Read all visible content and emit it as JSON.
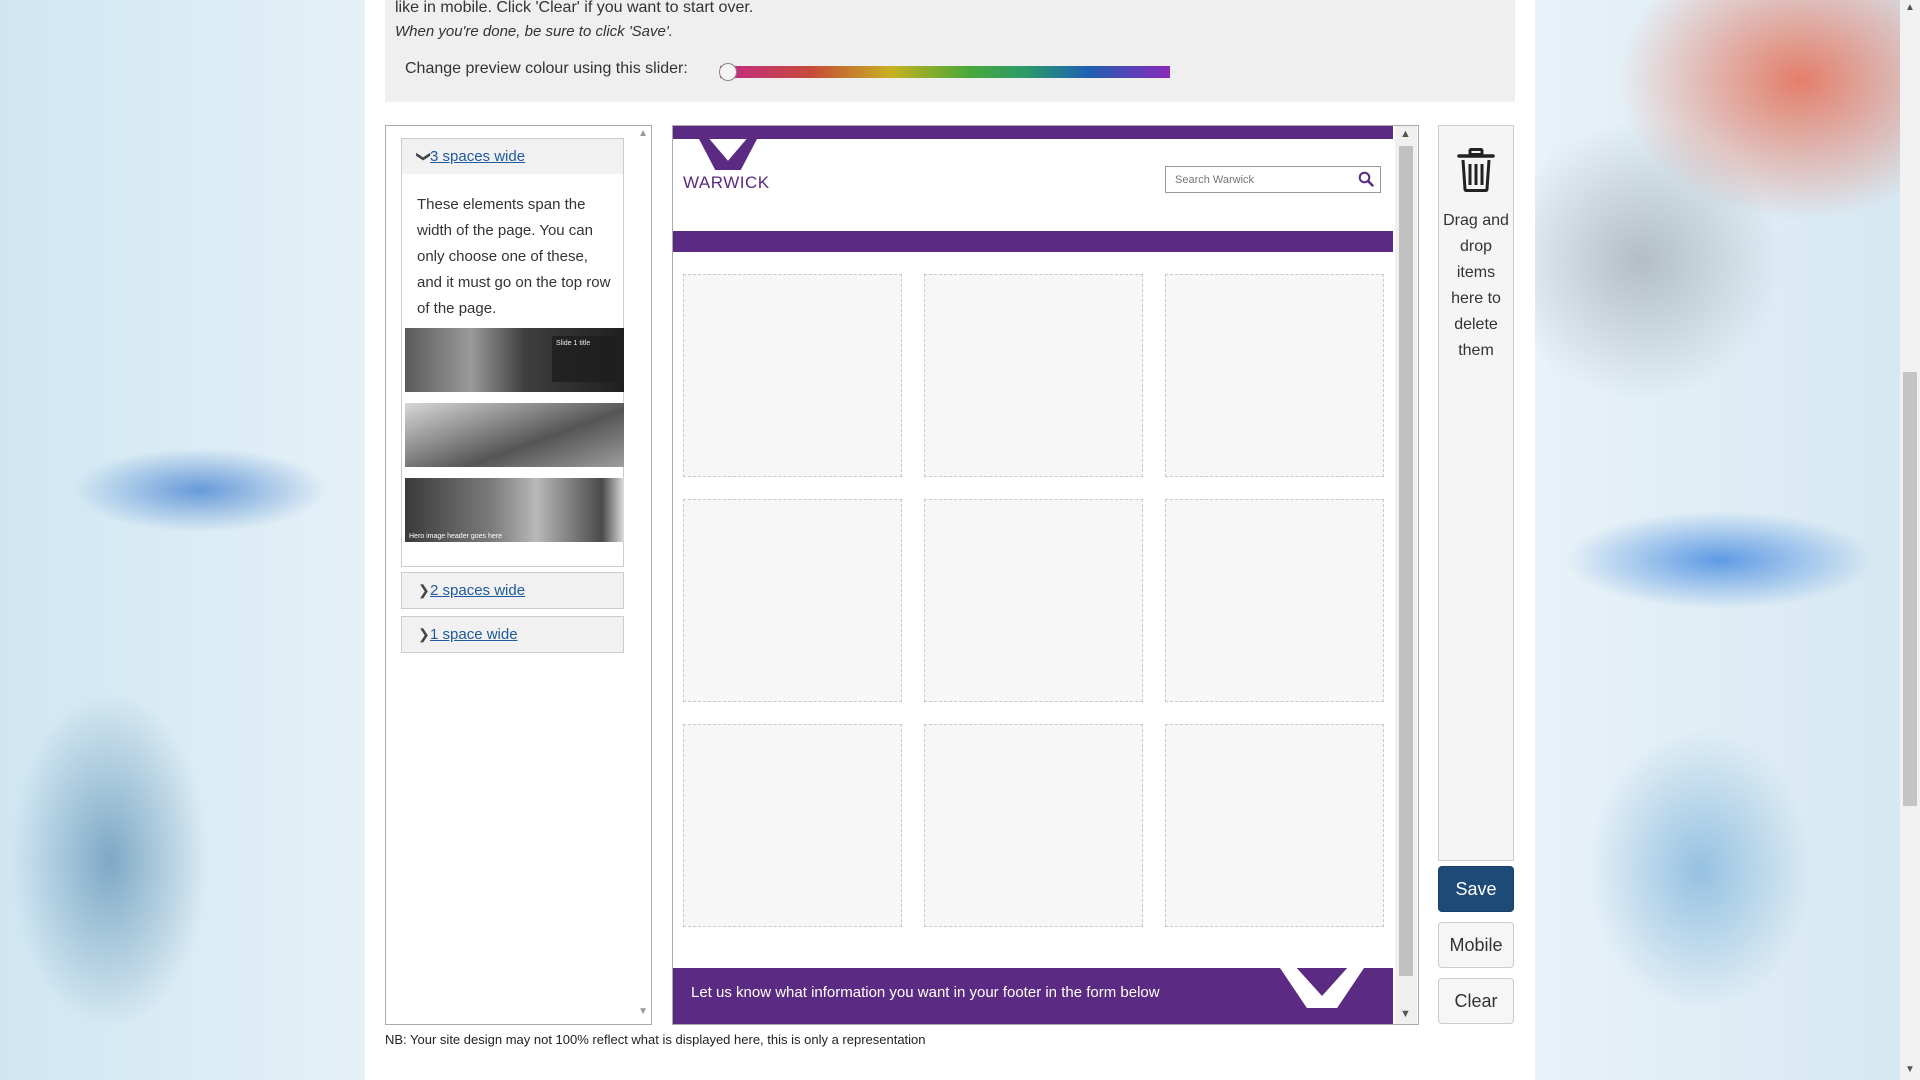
{
  "intro": {
    "line1": "like in mobile. Click 'Clear' if you want to start over.",
    "line2": "When you're done, be sure to click 'Save'."
  },
  "slider": {
    "label": "Change preview colour using this slider:",
    "value": 0
  },
  "palette": {
    "sections": [
      {
        "title": "3 spaces wide",
        "expanded": true,
        "icon": "chevron-down-icon"
      },
      {
        "title": "2 spaces wide",
        "expanded": false,
        "icon": "chevron-right-icon"
      },
      {
        "title": "1 space wide",
        "expanded": false,
        "icon": "chevron-right-icon"
      }
    ],
    "description": "These elements span the width of the page. You can only choose one of these, and it must go on the top row of the page.",
    "thumbnails": {
      "slide_title": "Slide 1 title",
      "hero_caption": "Hero image header goes here"
    }
  },
  "preview": {
    "logo_text": "WARWICK",
    "search_placeholder": "Search Warwick",
    "search_icon": "search-icon",
    "footer_text": "Let us know what information you want in your footer in the form below",
    "accent_color": "#5b2a82"
  },
  "trash": {
    "icon": "trash-icon",
    "text": "Drag and drop items here to delete them"
  },
  "buttons": {
    "save": "Save",
    "mobile": "Mobile",
    "clear": "Clear"
  },
  "disclaimer": "NB: Your site design may not 100% reflect what is displayed here, this is only a representation"
}
